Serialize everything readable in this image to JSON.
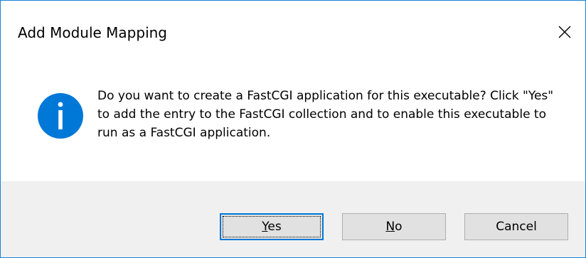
{
  "window": {
    "title": "Add Module Mapping",
    "close_icon": "close-icon"
  },
  "message": {
    "icon": "info-icon",
    "text": "Do you want to create a FastCGI application for this executable? Click \"Yes\" to add the entry to the FastCGI collection and to enable this executable to run as a FastCGI application."
  },
  "buttons": {
    "yes": {
      "mnemonic": "Y",
      "rest": "es"
    },
    "no": {
      "mnemonic": "N",
      "rest": "o"
    },
    "cancel": {
      "label": "Cancel"
    }
  },
  "colors": {
    "window_border": "#1883d7",
    "icon_blue": "#0078d7",
    "footer_bg": "#f0f0f0",
    "button_bg": "#e1e1e1",
    "button_border": "#adadad",
    "default_button_border": "#0078d7"
  }
}
